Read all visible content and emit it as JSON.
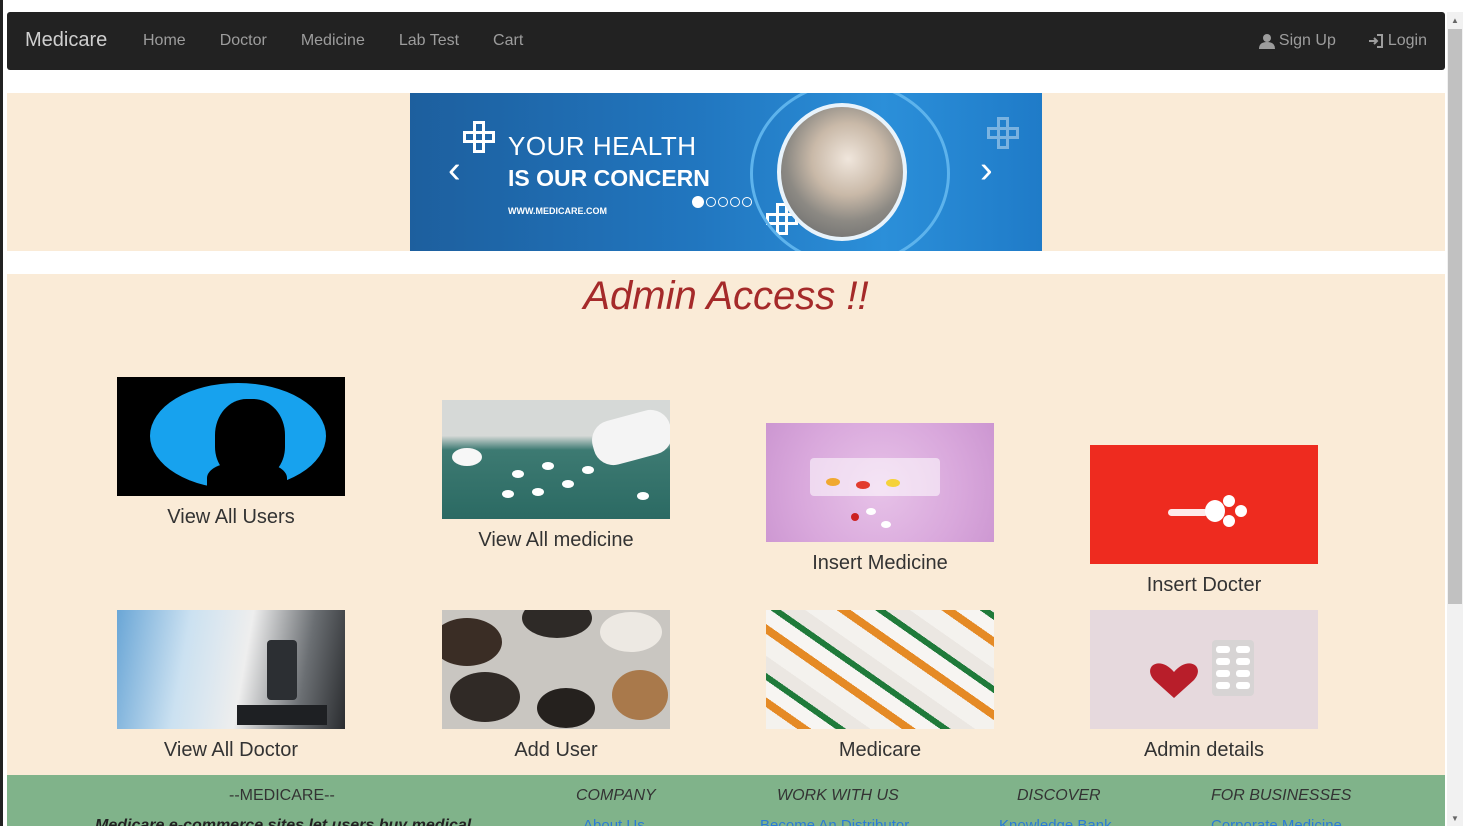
{
  "navbar": {
    "brand": "Medicare",
    "links": [
      "Home",
      "Doctor",
      "Medicine",
      "Lab Test",
      "Cart"
    ],
    "signup": "Sign Up",
    "login": "Login"
  },
  "carousel": {
    "line1": "YOUR HEALTH",
    "line2": "IS OUR CONCERN",
    "url": "WWW.MEDICARE.COM",
    "slides": 5,
    "active_slide": 1
  },
  "admin": {
    "title": "Admin Access !!",
    "cards": [
      {
        "label": "View All Users",
        "image": "user-silhouette-image"
      },
      {
        "label": "View All medicine",
        "image": "spilled-pills-image"
      },
      {
        "label": "Insert Medicine",
        "image": "pill-organizer-image"
      },
      {
        "label": "Insert Docter",
        "image": "pill-arrow-image"
      },
      {
        "label": "View All Doctor",
        "image": "microscope-image"
      },
      {
        "label": "Add User",
        "image": "capsule-bowls-image"
      },
      {
        "label": "Medicare",
        "image": "pills-thermometer-image"
      },
      {
        "label": "Admin details",
        "image": "heart-blister-image"
      }
    ]
  },
  "footer": {
    "brand": "--MEDICARE--",
    "description": "Medicare e-commerce sites let users buy medical",
    "columns": [
      {
        "heading": "COMPANY",
        "link": "About Us"
      },
      {
        "heading": "WORK WITH US",
        "link": "Become An Distributor"
      },
      {
        "heading": "DISCOVER",
        "link": "Knowledge Bank"
      },
      {
        "heading": "FOR BUSINESSES",
        "link": "Corporate Medicine"
      }
    ]
  },
  "colors": {
    "navbar_bg": "#222222",
    "section_bg": "#faebd7",
    "title_color": "#a52a2a",
    "footer_bg": "#80b38a",
    "link_color": "#2a7bd6"
  }
}
